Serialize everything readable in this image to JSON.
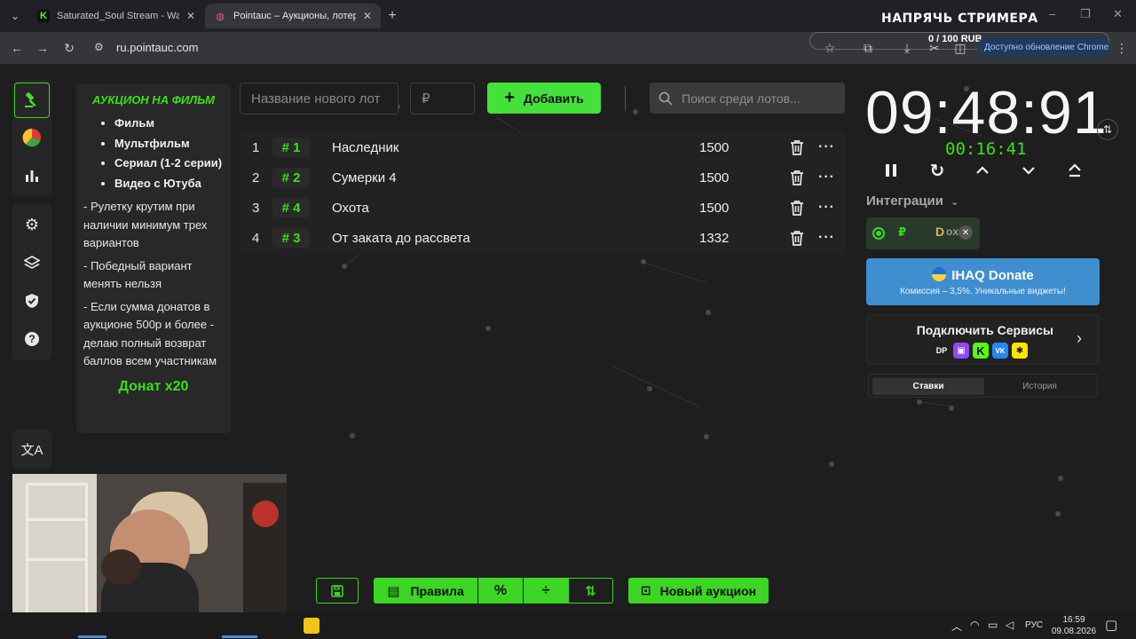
{
  "browser": {
    "tabs": [
      {
        "title": "Saturated_Soul Stream - Watch",
        "favicon": "K",
        "favicon_color": "#53fc18"
      },
      {
        "title": "Pointauc – Аукционы, лотереи",
        "favicon": "◍",
        "favicon_color": "#e84f9c"
      }
    ],
    "url": "ru.pointauc.com",
    "update_label": "Доступно обновление Chrome"
  },
  "overlay": {
    "stream_title": "НАПРЯЧЬ СТРИМЕРА",
    "donate_goal": "0 / 100 RUB"
  },
  "rules_card": {
    "title": "АУКЦИОН НА ФИЛЬМ",
    "items": [
      "Фильм",
      "Мультфильм",
      "Сериал (1-2 серии)",
      "Видео с Ютуба"
    ],
    "notes": [
      "- Рулетку крутим при наличии минимум трех вариантов",
      "- Победный вариант менять нельзя",
      "-  Если сумма донатов в аукционе 500р и более - делаю полный возврат баллов всем участникам"
    ],
    "footer": "Донат х20"
  },
  "form": {
    "name_placeholder": "Название нового лот",
    "amount_placeholder": "₽",
    "add_label": "Добавить",
    "search_placeholder": "Поиск среди лотов..."
  },
  "lots": [
    {
      "num": "1",
      "id": "# 1",
      "name": "Наследник",
      "amount": "1500"
    },
    {
      "num": "2",
      "id": "# 2",
      "name": "Сумерки 4",
      "amount": "1500"
    },
    {
      "num": "3",
      "id": "# 4",
      "name": "Охота",
      "amount": "1500"
    },
    {
      "num": "4",
      "id": "# 3",
      "name": "От заката до рассвета",
      "amount": "1332"
    }
  ],
  "timer": {
    "main": "09:48:91",
    "sub": "00:16:41"
  },
  "integrations": {
    "label": "Интеграции",
    "ihaq_title": "IHAQ Donate",
    "ihaq_sub": "Комиссия – 3,5%. Уникальные виджеты!",
    "connect_label": "Подключить Сервисы",
    "tab_bids": "Ставки",
    "tab_history": "История"
  },
  "bottom_bar": {
    "rules_label": "Правила",
    "new_auction_label": "Новый аукцион"
  },
  "taskbar": {
    "lang": "РУС",
    "time": "16:59",
    "date": "09.08.2026"
  },
  "colors": {
    "accent_green": "#3cd624",
    "ihaq_blue": "#3f8fd0",
    "background": "#1e1e1e"
  }
}
